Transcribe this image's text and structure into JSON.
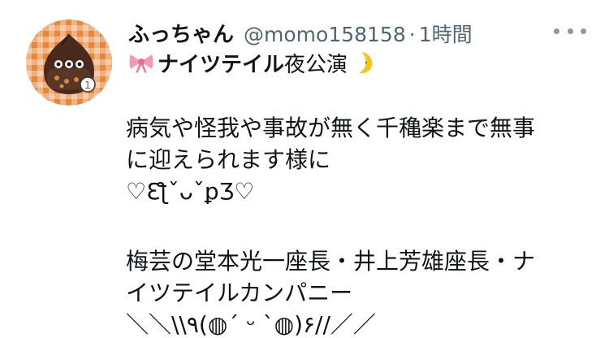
{
  "tweet": {
    "display_name": "ふっちゃん",
    "handle": "@momo158158",
    "separator": "·",
    "time": "1時間",
    "subline_bold": "ナイツテイル",
    "subline_normal": "夜公演",
    "ribbon_icon": "ribbon-emoji",
    "moon_icon": "crescent-moon-emoji",
    "more_icon": "more-dots-icon",
    "body_paragraph_1": "病気や怪我や事故が無く千穐楽まで無事\nに迎えられます様に\n♡ƐƪˇᴗˇꝑƷ♡",
    "body_paragraph_2": "梅芸の堂本光一座長・井上芳雄座長・ナ\nイツテイルカンパニー\n＼＼\\\\٩(◍ˊ ᵕ ˋ◍)۶//／／"
  },
  "colors": {
    "text": "#0f1419",
    "secondary": "#536471",
    "avatar_bg": "#e8863a"
  }
}
